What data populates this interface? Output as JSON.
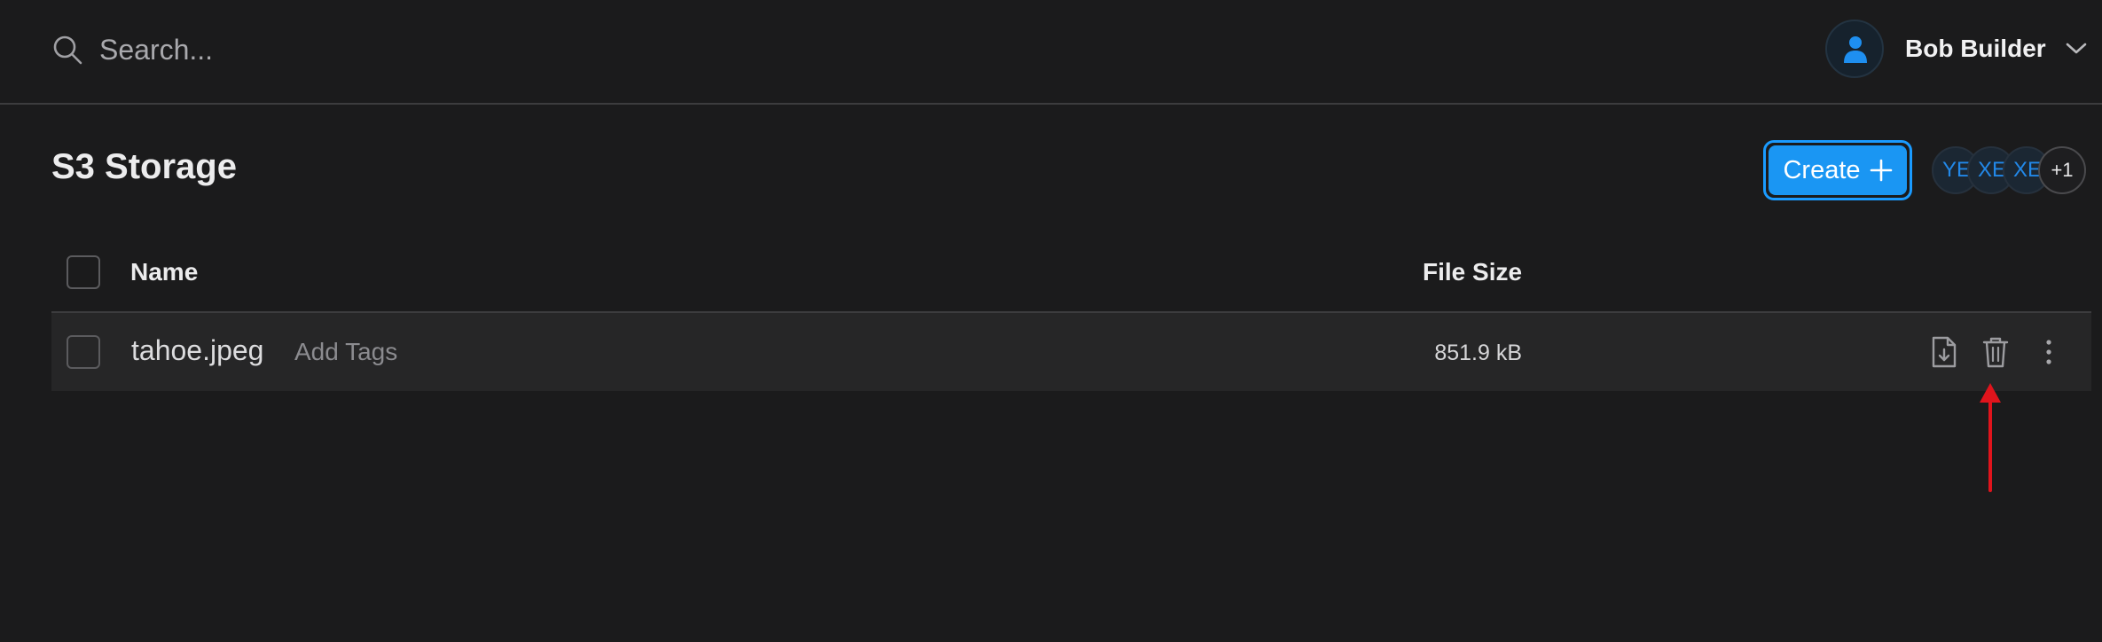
{
  "search": {
    "placeholder": "Search..."
  },
  "user": {
    "name": "Bob Builder"
  },
  "page": {
    "title": "S3 Storage"
  },
  "toolbar": {
    "create_label": "Create"
  },
  "collaborators": {
    "avatars": [
      "YE",
      "XE",
      "XE"
    ],
    "overflow": "+1"
  },
  "table": {
    "columns": {
      "name": "Name",
      "file_size": "File Size"
    },
    "rows": [
      {
        "name": "tahoe.jpeg",
        "tags_placeholder": "Add Tags",
        "size": "851.9 kB"
      }
    ]
  },
  "icons": {
    "search": "search-icon",
    "user": "user-icon",
    "chevron": "chevron-down-icon",
    "plus": "plus-icon",
    "download": "file-download-icon",
    "delete": "trash-icon",
    "more": "more-vertical-icon",
    "annotation": "red-arrow-icon"
  },
  "colors": {
    "accent": "#1a96f3",
    "background": "#1b1b1c",
    "annotation": "#e0141c"
  }
}
